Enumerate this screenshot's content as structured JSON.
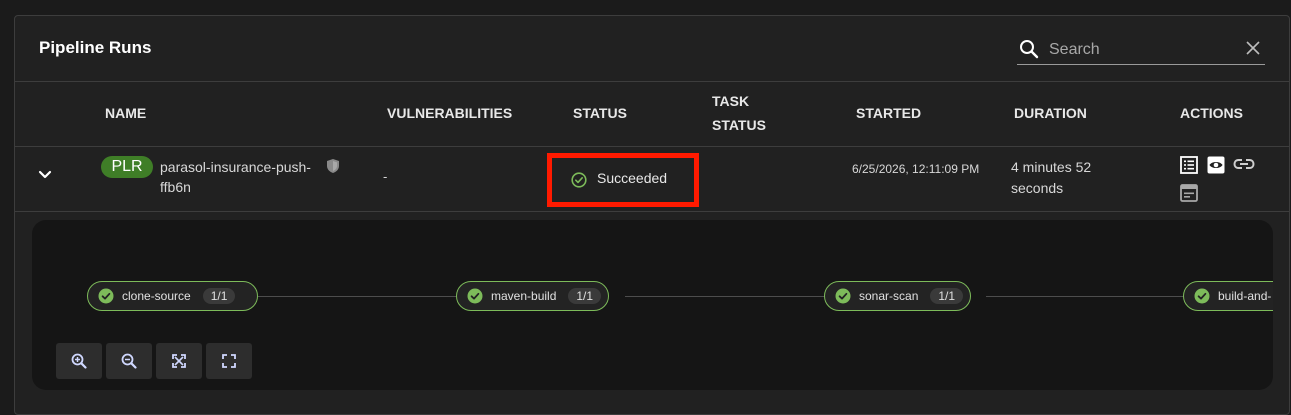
{
  "panel": {
    "title": "Pipeline Runs",
    "search": {
      "placeholder": "Search",
      "value": ""
    }
  },
  "table": {
    "headers": {
      "name": "NAME",
      "vulnerabilities": "VULNERABILITIES",
      "status": "STATUS",
      "task_status_line1": "TASK",
      "task_status_line2": "STATUS",
      "started": "STARTED",
      "duration": "DURATION",
      "actions": "ACTIONS"
    },
    "rows": [
      {
        "badge": "PLR",
        "name": "parasol-insurance-push-ffb6n",
        "vulnerabilities": "-",
        "status": "Succeeded",
        "started": "6/25/2026, 12:11:09 PM",
        "duration": "4 minutes 52 seconds"
      }
    ]
  },
  "pipeline": {
    "tasks": [
      {
        "name": "clone-source",
        "count": "1/1"
      },
      {
        "name": "maven-build",
        "count": "1/1"
      },
      {
        "name": "sonar-scan",
        "count": "1/1"
      },
      {
        "name": "build-and-",
        "count": ""
      }
    ],
    "controls": [
      "zoom-in-icon",
      "zoom-out-icon",
      "fit-to-screen-icon",
      "reset-view-icon"
    ]
  },
  "colors": {
    "badge_green": "#3f7e27",
    "success_green": "#7dbb5a",
    "highlight_red": "#ff1a00"
  }
}
